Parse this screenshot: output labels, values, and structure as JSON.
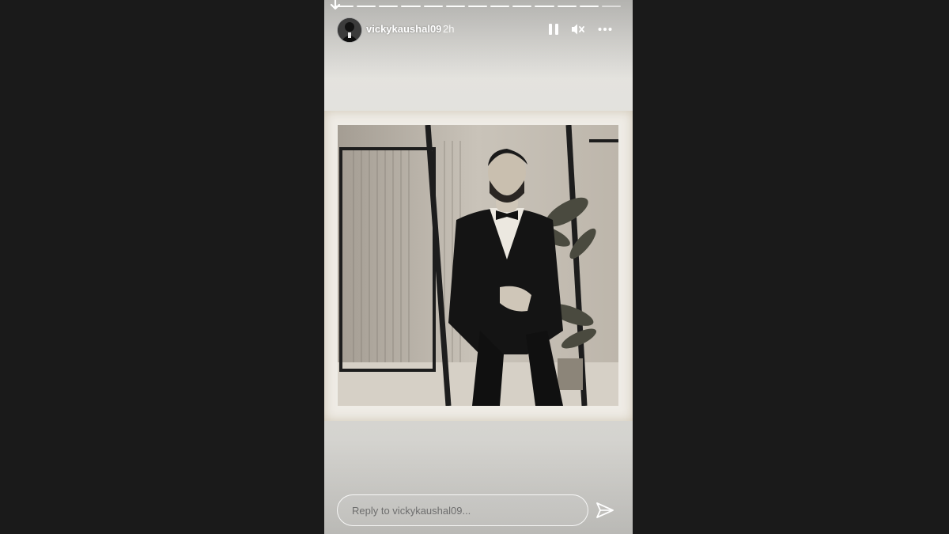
{
  "story": {
    "username": "vickykaushal09",
    "time_ago": "2h",
    "progress_segments": 13,
    "current_segment": 13
  },
  "icons": {
    "download": "arrow-down-icon",
    "pause": "pause-icon",
    "mute": "speaker-muted-icon",
    "more": "more-horizontal-icon",
    "send": "send-icon"
  },
  "reply": {
    "placeholder": "Reply to vickykaushal09..."
  },
  "colors": {
    "background": "#1a1a1a",
    "story_background": "#e2e1dd"
  }
}
